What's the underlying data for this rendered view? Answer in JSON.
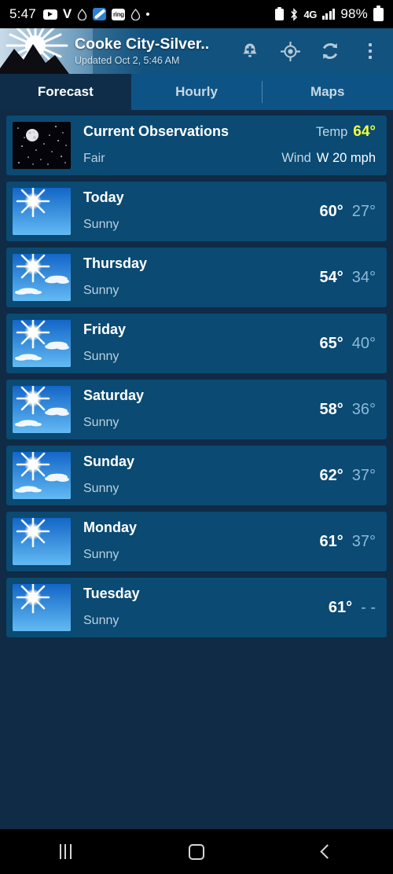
{
  "status_bar": {
    "clock": "5:47",
    "left_icons": [
      "youtube-icon",
      "v-letter-icon",
      "drop-icon",
      "blue-app-icon",
      "ring-icon",
      "drop-icon-2",
      "dot-icon"
    ],
    "ring_label": "ring",
    "v_label": "V",
    "network": "4G",
    "battery_percent": "98%",
    "right_icons": [
      "battery-saver-icon",
      "bluetooth-icon",
      "network-4g-icon",
      "signal-bars-icon",
      "battery-icon"
    ]
  },
  "header": {
    "title": "Cooke City-Silver..",
    "updated": "Updated Oct 2, 5:46 AM",
    "actions": [
      {
        "name": "add-alert-button",
        "icon": "bell-plus-icon"
      },
      {
        "name": "locate-button",
        "icon": "crosshair-icon"
      },
      {
        "name": "refresh-button",
        "icon": "refresh-icon"
      },
      {
        "name": "overflow-menu-button",
        "icon": "kebab-menu-icon"
      }
    ]
  },
  "tabs": [
    {
      "label": "Forecast",
      "active": true
    },
    {
      "label": "Hourly",
      "active": false
    },
    {
      "label": "Maps",
      "active": false
    }
  ],
  "current_observations": {
    "title": "Current Observations",
    "condition": "Fair",
    "icon": "night-clear-icon",
    "temp_label": "Temp",
    "temp_value": "64°",
    "wind_label": "Wind",
    "wind_value": "W 20 mph"
  },
  "forecast": [
    {
      "day": "Today",
      "condition": "Sunny",
      "high": "60°",
      "low": "27°",
      "icon": "sunny-icon",
      "clouds": false
    },
    {
      "day": "Thursday",
      "condition": "Sunny",
      "high": "54°",
      "low": "34°",
      "icon": "sunny-clouds-icon",
      "clouds": true
    },
    {
      "day": "Friday",
      "condition": "Sunny",
      "high": "65°",
      "low": "40°",
      "icon": "sunny-clouds-icon",
      "clouds": true
    },
    {
      "day": "Saturday",
      "condition": "Sunny",
      "high": "58°",
      "low": "36°",
      "icon": "sunny-clouds-icon",
      "clouds": true
    },
    {
      "day": "Sunday",
      "condition": "Sunny",
      "high": "62°",
      "low": "37°",
      "icon": "sunny-clouds-icon",
      "clouds": true
    },
    {
      "day": "Monday",
      "condition": "Sunny",
      "high": "61°",
      "low": "37°",
      "icon": "sunny-icon",
      "clouds": false
    },
    {
      "day": "Tuesday",
      "condition": "Sunny",
      "high": "61°",
      "low": "- -",
      "icon": "sunny-icon",
      "clouds": false
    }
  ],
  "nav_bar": {
    "recents": "recents-button",
    "home": "home-button",
    "back": "back-button"
  },
  "colors": {
    "page_bg": "#102B45",
    "card_bg": "#0A4A73",
    "appbar": "#12527E",
    "tab_bar": "#0E5385",
    "tab_active": "#0F2D48",
    "temp_accent": "#F3FF3A",
    "low_temp": "#8FB8D8"
  }
}
